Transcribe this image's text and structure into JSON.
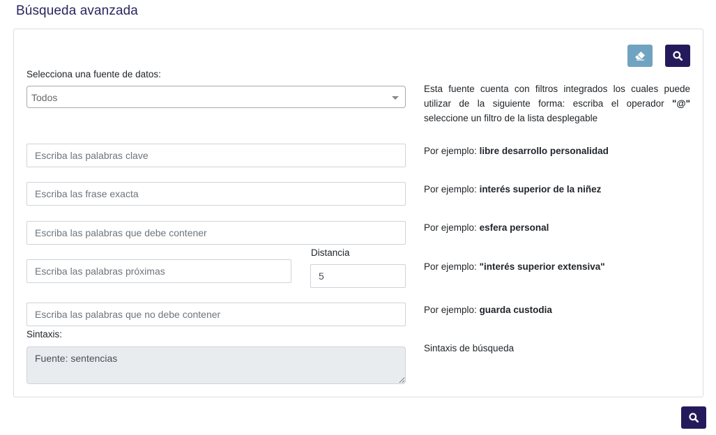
{
  "page": {
    "title": "Búsqueda avanzada"
  },
  "colors": {
    "primary": "#241a5b",
    "clear": "#6fa3c1",
    "title": "#2a2560"
  },
  "toolbar": {
    "clear_icon": "eraser-icon",
    "search_icon": "search-icon"
  },
  "source": {
    "label": "Selecciona una fuente de datos:",
    "selected": "Todos"
  },
  "info": {
    "text_before": "Esta fuente cuenta con filtros integrados los cuales puede utilizar de la siguiente forma: escriba el operador",
    "operator": "\"@\"",
    "text_after": "seleccione un filtro de la lista desplegable"
  },
  "fields": {
    "keywords_placeholder": "Escriba las palabras clave",
    "exact_placeholder": "Escriba las frase exacta",
    "must_contain_placeholder": "Escriba las palabras que debe contener",
    "proximity_placeholder": "Escriba las palabras próximas",
    "distance_label": "Distancia",
    "distance_value": "5",
    "exclude_placeholder": "Escriba las palabras que no debe contener"
  },
  "examples": {
    "prefix": "Por ejemplo:",
    "keywords": "libre desarrollo personalidad",
    "exact": "interés superior de la niñez",
    "must_contain": "esfera personal",
    "proximity": "\"interés superior extensiva\"",
    "exclude": "guarda custodia"
  },
  "syntax": {
    "label": "Sintaxis:",
    "value": "Fuente: sentencias",
    "help": "Sintaxis de búsqueda"
  }
}
